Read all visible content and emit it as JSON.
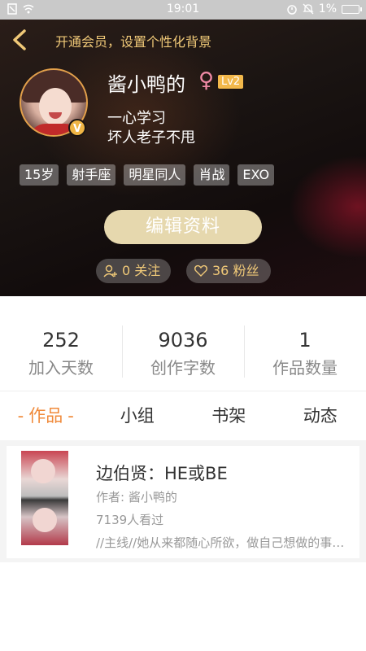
{
  "status_bar": {
    "time": "19:01",
    "battery": "1%"
  },
  "header": {
    "vip_banner": "开通会员，设置个性化背景",
    "username": "酱小鸭的",
    "gender_symbol": "♀",
    "level": "Lv2",
    "vip_badge": "V",
    "bio_line1": "一心学习",
    "bio_line2": "坏人老子不甩",
    "tags": [
      "15岁",
      "射手座",
      "明星同人",
      "肖战",
      "EXO"
    ],
    "edit_button": "编辑资料",
    "following": "0 关注",
    "followers": "36 粉丝"
  },
  "stats": [
    {
      "value": "252",
      "label": "加入天数"
    },
    {
      "value": "9036",
      "label": "创作字数"
    },
    {
      "value": "1",
      "label": "作品数量"
    }
  ],
  "tabs": [
    "作品",
    "小组",
    "书架",
    "动态"
  ],
  "works": [
    {
      "title": "边伯贤：HE或BE",
      "author": "作者: 酱小鸭的",
      "views": "7139人看过",
      "description": "//主线//她从来都随心所欲，做自己想做的事…"
    }
  ],
  "colors": {
    "accent": "#f08a3a",
    "gold": "#f0c978",
    "edit_button": "#e6d8ae",
    "level_badge": "#f2b84b"
  }
}
